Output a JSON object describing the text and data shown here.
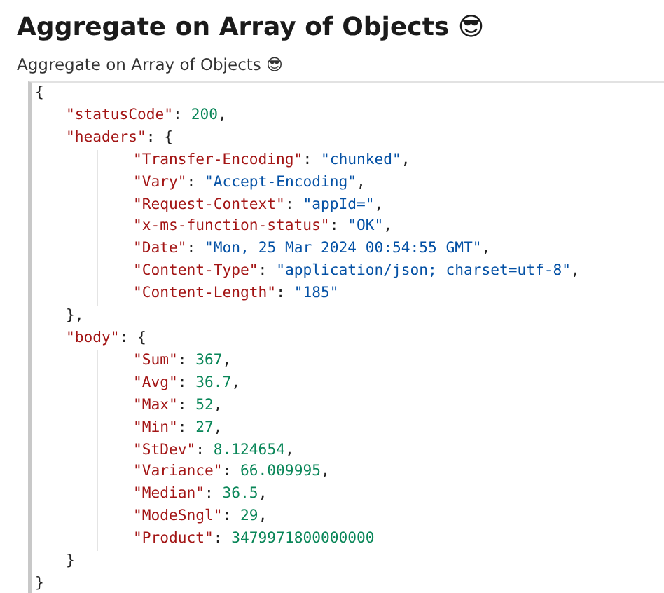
{
  "title": "Aggregate on Array of Objects 😎",
  "subtitle": "Aggregate on Array of Objects 😎",
  "response": {
    "open": "{",
    "close": "}",
    "children": [
      {
        "kind": "number",
        "key": "\"statusCode\"",
        "colon": ": ",
        "value": "200",
        "comma": ","
      },
      {
        "kind": "object",
        "key": "\"headers\"",
        "colon": ": ",
        "open": "{",
        "close": "}",
        "comma": ",",
        "children": [
          {
            "kind": "string",
            "key": "\"Transfer-Encoding\"",
            "colon": ": ",
            "value": "\"chunked\"",
            "comma": ","
          },
          {
            "kind": "string",
            "key": "\"Vary\"",
            "colon": ": ",
            "value": "\"Accept-Encoding\"",
            "comma": ","
          },
          {
            "kind": "string",
            "key": "\"Request-Context\"",
            "colon": ": ",
            "value": "\"appId=\"",
            "comma": ","
          },
          {
            "kind": "string",
            "key": "\"x-ms-function-status\"",
            "colon": ": ",
            "value": "\"OK\"",
            "comma": ","
          },
          {
            "kind": "string",
            "key": "\"Date\"",
            "colon": ": ",
            "value": "\"Mon, 25 Mar 2024 00:54:55 GMT\"",
            "comma": ","
          },
          {
            "kind": "string",
            "key": "\"Content-Type\"",
            "colon": ": ",
            "value": "\"application/json; charset=utf-8\"",
            "comma": ","
          },
          {
            "kind": "string",
            "key": "\"Content-Length\"",
            "colon": ": ",
            "value": "\"185\""
          }
        ]
      },
      {
        "kind": "object",
        "key": "\"body\"",
        "colon": ": ",
        "open": "{",
        "close": "}",
        "children": [
          {
            "kind": "number",
            "key": "\"Sum\"",
            "colon": ": ",
            "value": "367",
            "comma": ","
          },
          {
            "kind": "number",
            "key": "\"Avg\"",
            "colon": ": ",
            "value": "36.7",
            "comma": ","
          },
          {
            "kind": "number",
            "key": "\"Max\"",
            "colon": ": ",
            "value": "52",
            "comma": ","
          },
          {
            "kind": "number",
            "key": "\"Min\"",
            "colon": ": ",
            "value": "27",
            "comma": ","
          },
          {
            "kind": "number",
            "key": "\"StDev\"",
            "colon": ": ",
            "value": "8.124654",
            "comma": ","
          },
          {
            "kind": "number",
            "key": "\"Variance\"",
            "colon": ": ",
            "value": "66.009995",
            "comma": ","
          },
          {
            "kind": "number",
            "key": "\"Median\"",
            "colon": ": ",
            "value": "36.5",
            "comma": ","
          },
          {
            "kind": "number",
            "key": "\"ModeSngl\"",
            "colon": ": ",
            "value": "29",
            "comma": ","
          },
          {
            "kind": "number",
            "key": "\"Product\"",
            "colon": ": ",
            "value": "3479971800000000"
          }
        ]
      }
    ]
  }
}
